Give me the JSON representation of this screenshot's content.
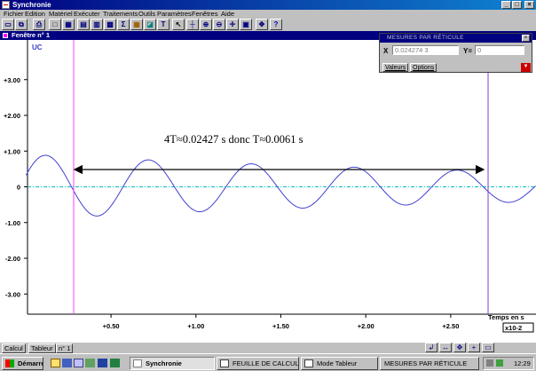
{
  "app": {
    "title": "Synchronie"
  },
  "menu": [
    "Fichier",
    "Edition",
    "Matériel",
    "Exécuter",
    "Traitements",
    "Outils",
    "Paramètres",
    "Fenêtres",
    "Aide"
  ],
  "toolbar_icons": [
    "new-acquisition-icon",
    "open-transfer-icon",
    "print-icon",
    "window-icon",
    "grid-icon",
    "display-icon",
    "table-icon",
    "calculator-icon",
    "sum-icon",
    "calc-sheet-icon",
    "modelling-icon",
    "text-icon",
    "pointer-icon",
    "cursor-icon",
    "zoom-icon",
    "zoom-out-icon",
    "crosshair-icon",
    "screen-icon",
    "move-icon",
    "help-icon"
  ],
  "child_window": {
    "title": "Fenêtre n° 1"
  },
  "mesures": {
    "title": "MESURES PAR RÉTICULE",
    "x_label": "X",
    "x_value": "0.024274 3",
    "y_label": "Y=",
    "y_value": "0",
    "tabs": [
      "Valeurs",
      "Options"
    ]
  },
  "status_tabs": [
    "Calcul",
    "Tableur",
    "n° 1"
  ],
  "taskbar": {
    "start": "Démarrer",
    "tasks": [
      "Synchronie",
      "FEUILLE DE CALCUL",
      "Mode Tableur",
      "MESURES PAR RÉTICULE"
    ],
    "clock": "12:29"
  },
  "chart_data": {
    "type": "line",
    "title": "",
    "xlabel": "Temps en s",
    "x_scale_label": "x10-2",
    "ylabel": "UC",
    "xlim": [
      0,
      3.0
    ],
    "ylim": [
      -3.4,
      3.4
    ],
    "x_ticks": [
      "+0.50",
      "+1.00",
      "+1.50",
      "+2.00",
      "+2.50"
    ],
    "x_tick_values": [
      0.5,
      1.0,
      1.5,
      2.0,
      2.5
    ],
    "y_ticks": [
      "+3.00",
      "+2.00",
      "+1.00",
      "0",
      "-1.00",
      "-2.00",
      "-3.00"
    ],
    "y_tick_values": [
      3,
      2,
      1,
      0,
      -1,
      -2,
      -3
    ],
    "series": [
      {
        "name": "UC",
        "color": "#4040d0",
        "amplitude0": 0.91,
        "decay": 0.26,
        "period": 0.606,
        "peak_t": 0.116
      }
    ],
    "cursors": [
      {
        "t": 0.28,
        "color": "#ff40ff"
      },
      {
        "t": 2.72,
        "color": "#8040d0"
      }
    ],
    "zero_line_color": "#00c0c0",
    "annotation": "4T≈0.02427 s donc T≈0.0061 s"
  }
}
